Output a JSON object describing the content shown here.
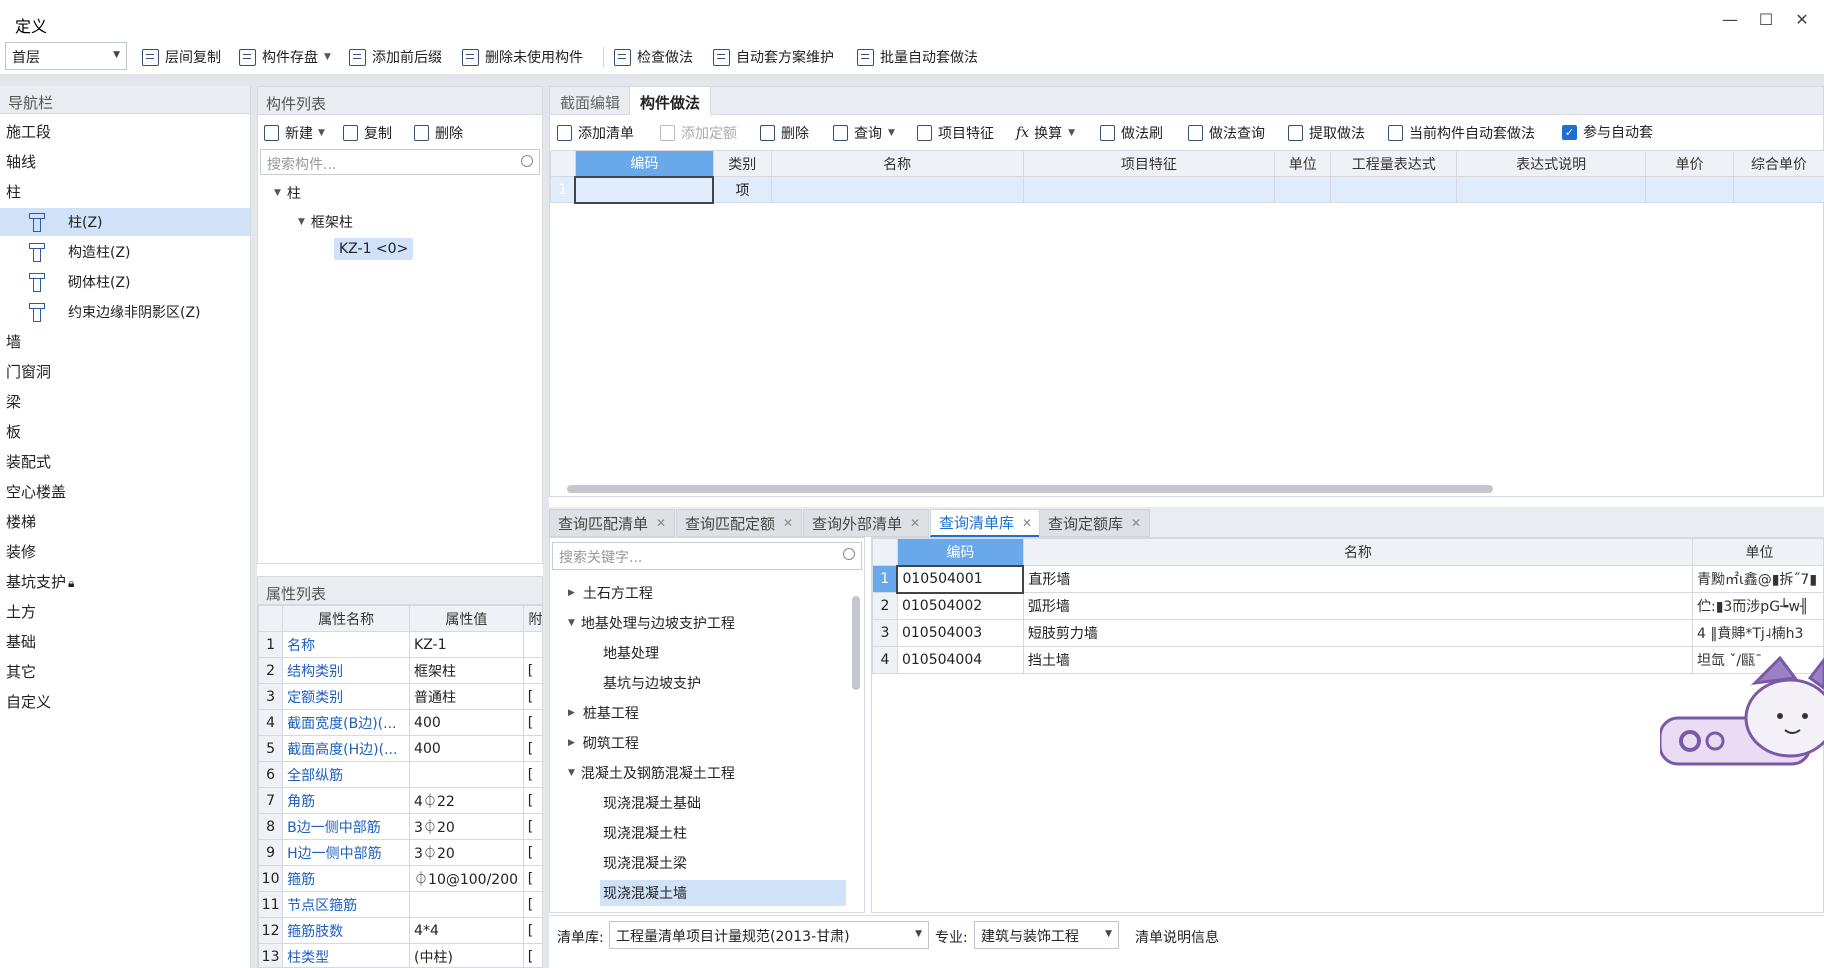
{
  "window": {
    "title": "定义",
    "minimize": "—",
    "maximize": "☐",
    "close": "✕"
  },
  "toolbar": {
    "floor": "首层",
    "items": [
      "层间复制",
      "构件存盘",
      "添加前后缀",
      "删除未使用构件",
      "检查做法",
      "自动套方案维护",
      "批量自动套做法"
    ]
  },
  "nav": {
    "header": "导航栏",
    "items": [
      "施工段",
      "轴线",
      "柱",
      "墙",
      "门窗洞",
      "梁",
      "板",
      "装配式",
      "空心楼盖",
      "楼梯",
      "装修",
      "基坑支护",
      "土方",
      "基础",
      "其它",
      "自定义"
    ],
    "column_sub": [
      "柱(Z)",
      "构造柱(Z)",
      "砌体柱(Z)",
      "约束边缘非阴影区(Z)"
    ],
    "lock_icon": "lock-icon"
  },
  "components": {
    "header": "构件列表",
    "new": "新建",
    "copy": "复制",
    "delete": "删除",
    "search_placeholder": "搜索构件...",
    "tree": {
      "root": "柱",
      "child": "框架柱",
      "leaf": "KZ-1 <0>"
    }
  },
  "properties": {
    "header": "属性列表",
    "cols": [
      "属性名称",
      "属性值",
      "附"
    ],
    "rows": [
      {
        "n": "1",
        "name": "名称",
        "value": "KZ-1"
      },
      {
        "n": "2",
        "name": "结构类别",
        "value": "框架柱"
      },
      {
        "n": "3",
        "name": "定额类别",
        "value": "普通柱"
      },
      {
        "n": "4",
        "name": "截面宽度(B边)(...",
        "value": "400"
      },
      {
        "n": "5",
        "name": "截面高度(H边)(...",
        "value": "400"
      },
      {
        "n": "6",
        "name": "全部纵筋",
        "value": ""
      },
      {
        "n": "7",
        "name": "角筋",
        "value": "4⏀22"
      },
      {
        "n": "8",
        "name": "B边一侧中部筋",
        "value": "3⏀20"
      },
      {
        "n": "9",
        "name": "H边一侧中部筋",
        "value": "3⏀20"
      },
      {
        "n": "10",
        "name": "箍筋",
        "value": "⏀10@100/200"
      },
      {
        "n": "11",
        "name": "节点区箍筋",
        "value": ""
      },
      {
        "n": "12",
        "name": "箍筋肢数",
        "value": "4*4"
      },
      {
        "n": "13",
        "name": "柱类型",
        "value": "(中柱)"
      }
    ]
  },
  "method": {
    "tabs": [
      "截面编辑",
      "构件做法"
    ],
    "toolbar": [
      "添加清单",
      "添加定额",
      "删除",
      "查询",
      "项目特征",
      "换算",
      "做法刷",
      "做法查询",
      "提取做法",
      "当前构件自动套做法",
      "参与自动套"
    ],
    "fx": "fx",
    "cols": [
      "编码",
      "类别",
      "名称",
      "项目特征",
      "单位",
      "工程量表达式",
      "表达式说明",
      "单价",
      "综合单价"
    ],
    "row": {
      "n": "1",
      "type": "项"
    }
  },
  "query_tabs": [
    "查询匹配清单",
    "查询匹配定额",
    "查询外部清单",
    "查询清单库",
    "查询定额库"
  ],
  "library": {
    "search_placeholder": "搜索关键字...",
    "tree": [
      {
        "label": "土石方工程",
        "level": 0,
        "state": "collapsed"
      },
      {
        "label": "地基处理与边坡支护工程",
        "level": 0,
        "state": "expanded"
      },
      {
        "label": "地基处理",
        "level": 1,
        "state": "leaf"
      },
      {
        "label": "基坑与边坡支护",
        "level": 1,
        "state": "leaf"
      },
      {
        "label": "桩基工程",
        "level": 0,
        "state": "collapsed"
      },
      {
        "label": "砌筑工程",
        "level": 0,
        "state": "collapsed"
      },
      {
        "label": "混凝土及钢筋混凝土工程",
        "level": 0,
        "state": "expanded"
      },
      {
        "label": "现浇混凝土基础",
        "level": 1,
        "state": "leaf"
      },
      {
        "label": "现浇混凝土柱",
        "level": 1,
        "state": "leaf"
      },
      {
        "label": "现浇混凝土梁",
        "level": 1,
        "state": "leaf"
      },
      {
        "label": "现浇混凝土墙",
        "level": 1,
        "state": "selected"
      }
    ],
    "cols": [
      "编码",
      "名称",
      "单位"
    ],
    "rows": [
      {
        "n": "1",
        "code": "010504001",
        "name": "直形墙",
        "unit": "青黝㎡ι鑫@▮拆˝7▮"
      },
      {
        "n": "2",
        "code": "010504002",
        "name": "弧形墙",
        "unit": "伫:▮3而涉pG┶w╢"
      },
      {
        "n": "3",
        "code": "010504003",
        "name": "短肢剪力墙",
        "unit": "4 ‖賁賗*Tj˨楠h3"
      },
      {
        "n": "4",
        "code": "010504004",
        "name": "挡土墙",
        "unit": "坦氙 ˇ/甌ˉ"
      }
    ]
  },
  "status": {
    "lib_label": "清单库:",
    "lib_value": "工程量清单项目计量规范(2013-甘肃)",
    "spec_label": "专业:",
    "spec_value": "建筑与装饰工程",
    "info": "清单说明信息"
  },
  "colors": {
    "accent": "#6aa8ec",
    "selection": "#cfe2f8",
    "link": "#1f5fbf"
  }
}
